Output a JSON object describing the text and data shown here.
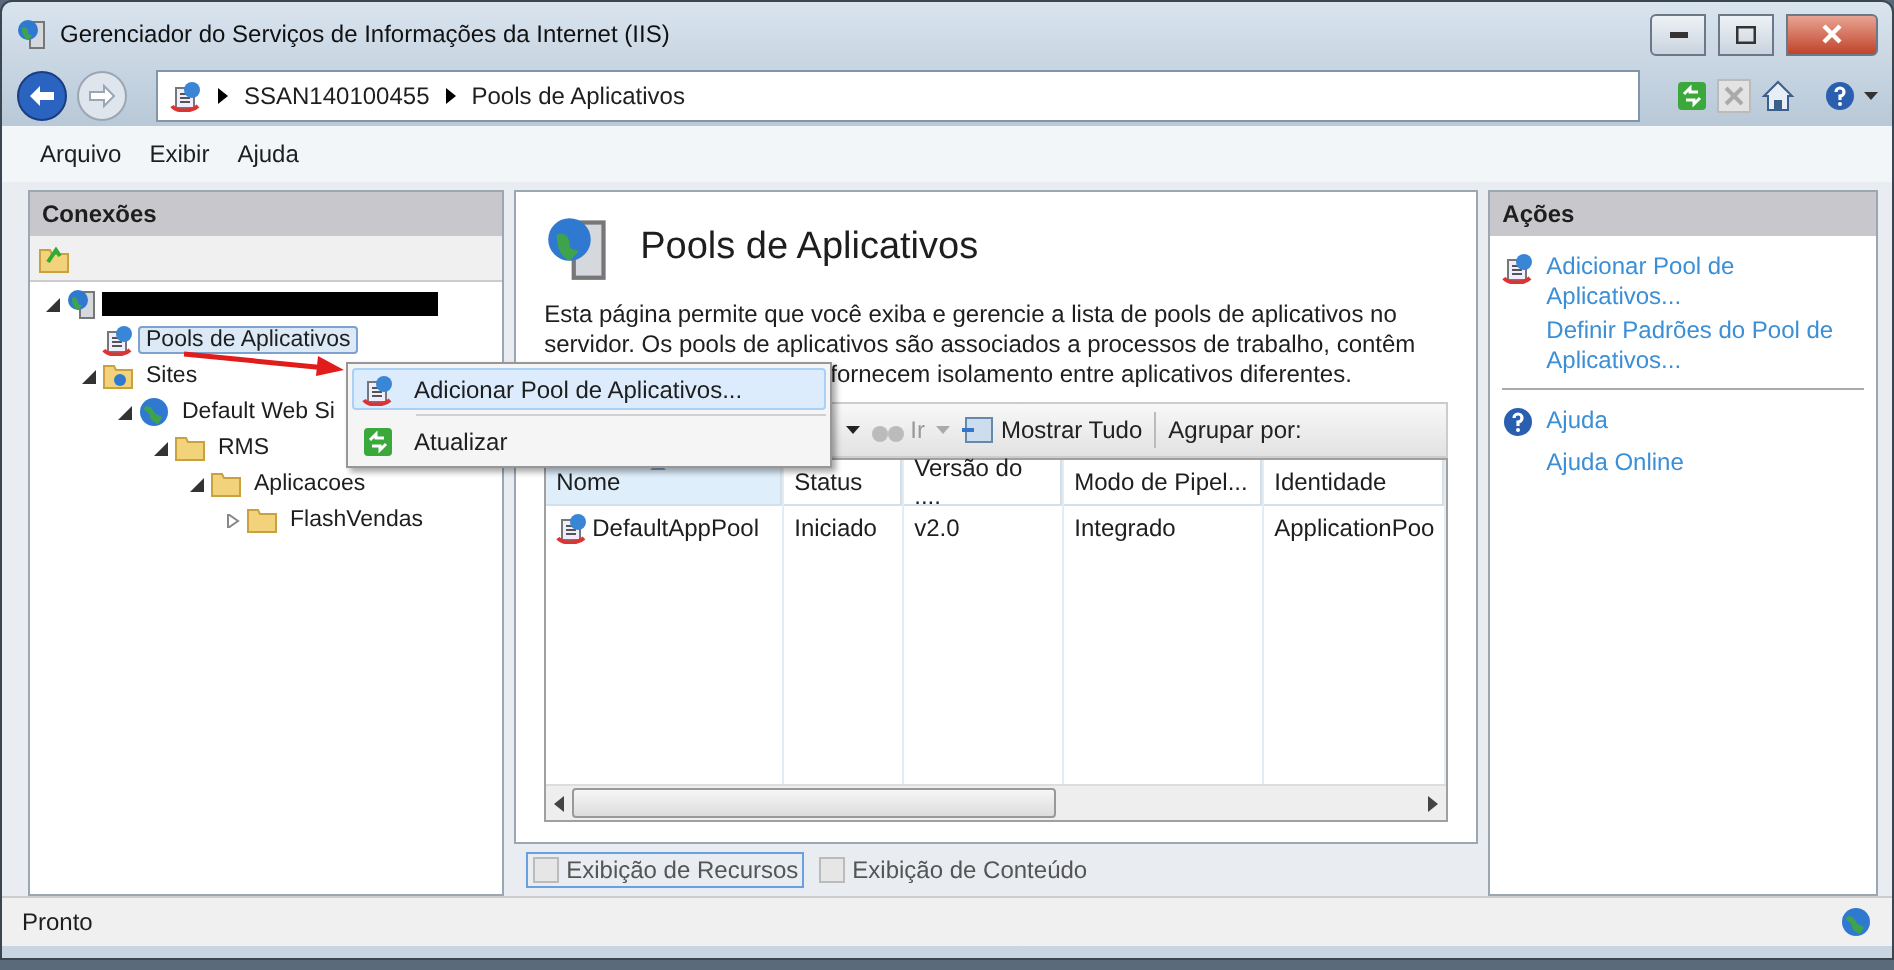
{
  "window": {
    "title": "Gerenciador do Serviços de Informações da Internet (IIS)"
  },
  "address_bar": {
    "crumbs": [
      "SSAN140100455",
      "Pools de Aplicativos"
    ]
  },
  "menu_bar": [
    "Arquivo",
    "Exibir",
    "Ajuda"
  ],
  "connections": {
    "title": "Conexões",
    "tree": [
      {
        "kind": "redacted",
        "expanded": true,
        "selected": false,
        "children": [
          {
            "kind": "pool",
            "label": "Pools de Aplicativos",
            "selected": true
          },
          {
            "kind": "sites",
            "label": "Sites",
            "expanded": true,
            "selected": false,
            "children": [
              {
                "kind": "site",
                "label": "Default Web Si",
                "expanded": true,
                "selected": false,
                "children": [
                  {
                    "kind": "folder",
                    "label": "RMS",
                    "expanded": true,
                    "selected": false,
                    "children": [
                      {
                        "kind": "folder",
                        "label": "Aplicacoes",
                        "expanded": true,
                        "selected": false,
                        "children": [
                          {
                            "kind": "folder",
                            "label": "FlashVendas",
                            "expanded": false,
                            "selected": false
                          }
                        ]
                      }
                    ]
                  }
                ]
              }
            ]
          }
        ]
      }
    ]
  },
  "center": {
    "title": "Pools de Aplicativos",
    "description": [
      "Esta página permite que você exiba e gerencie a lista de pools de aplicativos no",
      "servidor. Os pools de aplicativos são associados a processos de trabalho, contêm",
      "fornecem isolamento entre aplicativos diferentes."
    ],
    "toolbar": {
      "go": "Ir",
      "show_all": "Mostrar Tudo",
      "group_by": "Agrupar por:"
    },
    "table": {
      "columns": [
        {
          "label": "Nome",
          "sorted": true
        },
        {
          "label": "Status",
          "sorted": false
        },
        {
          "label": "Versão do ....",
          "sorted": false
        },
        {
          "label": "Modo de Pipel...",
          "sorted": false
        },
        {
          "label": "Identidade",
          "sorted": false
        }
      ],
      "rows": [
        {
          "cells": [
            "DefaultAppPool",
            "Iniciado",
            "v2.0",
            "Integrado",
            "ApplicationPoo"
          ]
        }
      ]
    },
    "views": [
      {
        "label": "Exibição de Recursos",
        "selected": true
      },
      {
        "label": "Exibição de Conteúdo",
        "selected": false
      }
    ]
  },
  "actions": {
    "title": "Ações",
    "groups": [
      [
        {
          "kind": "pool",
          "label": "Adicionar Pool de Aplicativos..."
        },
        {
          "kind": "none",
          "label": "Definir Padrões do Pool de Aplicativos..."
        }
      ],
      [
        {
          "kind": "help",
          "label": "Ajuda"
        },
        {
          "kind": "none",
          "label": "Ajuda Online"
        }
      ]
    ]
  },
  "context_menu": {
    "items": [
      {
        "kind": "pool",
        "label": "Adicionar Pool de Aplicativos...",
        "selected": true
      },
      {
        "kind": "refresh",
        "label": "Atualizar",
        "selected": false
      }
    ]
  },
  "status_bar": {
    "text": "Pronto"
  }
}
